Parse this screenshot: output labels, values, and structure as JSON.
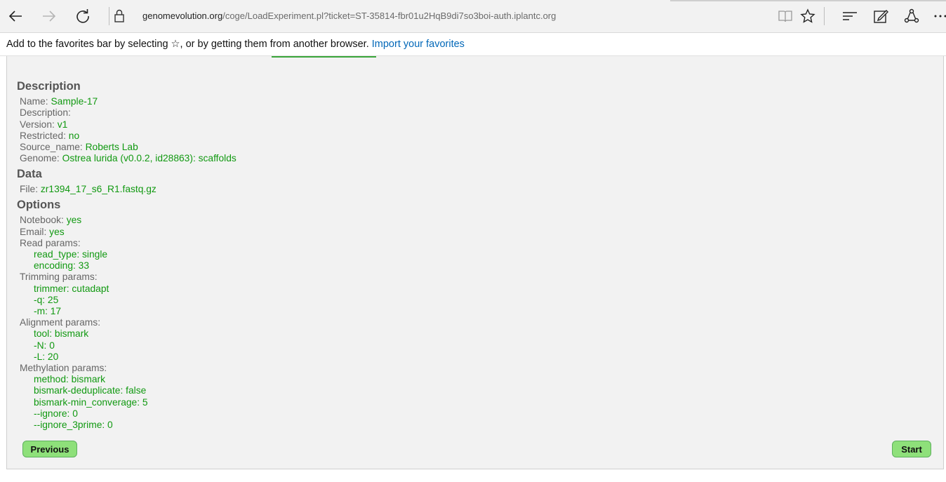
{
  "browser": {
    "url_host": "genomevolution.org",
    "url_path": "/coge/LoadExperiment.pl?ticket=ST-35814-fbr01u2HqB9di7so3boi-auth.iplantc.org",
    "icons": [
      "back-icon",
      "forward-icon",
      "refresh-icon",
      "lock-icon",
      "reading-view-icon",
      "favorite-star-icon",
      "hub-icon",
      "web-note-icon",
      "share-icon",
      "more-icon"
    ]
  },
  "favbar": {
    "message": "Add to the favorites bar by selecting ☆, or by getting them from another browser.",
    "link": "Import your favorites"
  },
  "description": {
    "heading": "Description",
    "fields": [
      {
        "label": "Name: ",
        "value": "Sample-17"
      },
      {
        "label": "Description:",
        "value": ""
      },
      {
        "label": "Version: ",
        "value": "v1"
      },
      {
        "label": "Restricted: ",
        "value": "no"
      },
      {
        "label": "Source_name: ",
        "value": "Roberts Lab"
      },
      {
        "label": "Genome: ",
        "value": "Ostrea lurida (v0.0.2, id28863): scaffolds"
      }
    ]
  },
  "data": {
    "heading": "Data",
    "file_label": "File: ",
    "file_value": "zr1394_17_s6_R1.fastq.gz"
  },
  "options": {
    "heading": "Options",
    "notebook_label": "Notebook: ",
    "notebook_value": "yes",
    "email_label": "Email: ",
    "email_value": "yes",
    "read_label": "Read params:",
    "read_params": [
      "read_type: single",
      "encoding: 33"
    ],
    "trim_label": "Trimming params:",
    "trim_params": [
      "trimmer: cutadapt",
      "-q: 25",
      "-m: 17"
    ],
    "align_label": "Alignment params:",
    "align_params": [
      "tool: bismark",
      "-N: 0",
      "-L: 20"
    ],
    "meth_label": "Methylation params:",
    "meth_params": [
      "method: bismark",
      "bismark-deduplicate: false",
      "bismark-min_converage: 5",
      "--ignore: 0",
      "--ignore_3prime: 0"
    ]
  },
  "buttons": {
    "previous": "Previous",
    "start": "Start"
  }
}
